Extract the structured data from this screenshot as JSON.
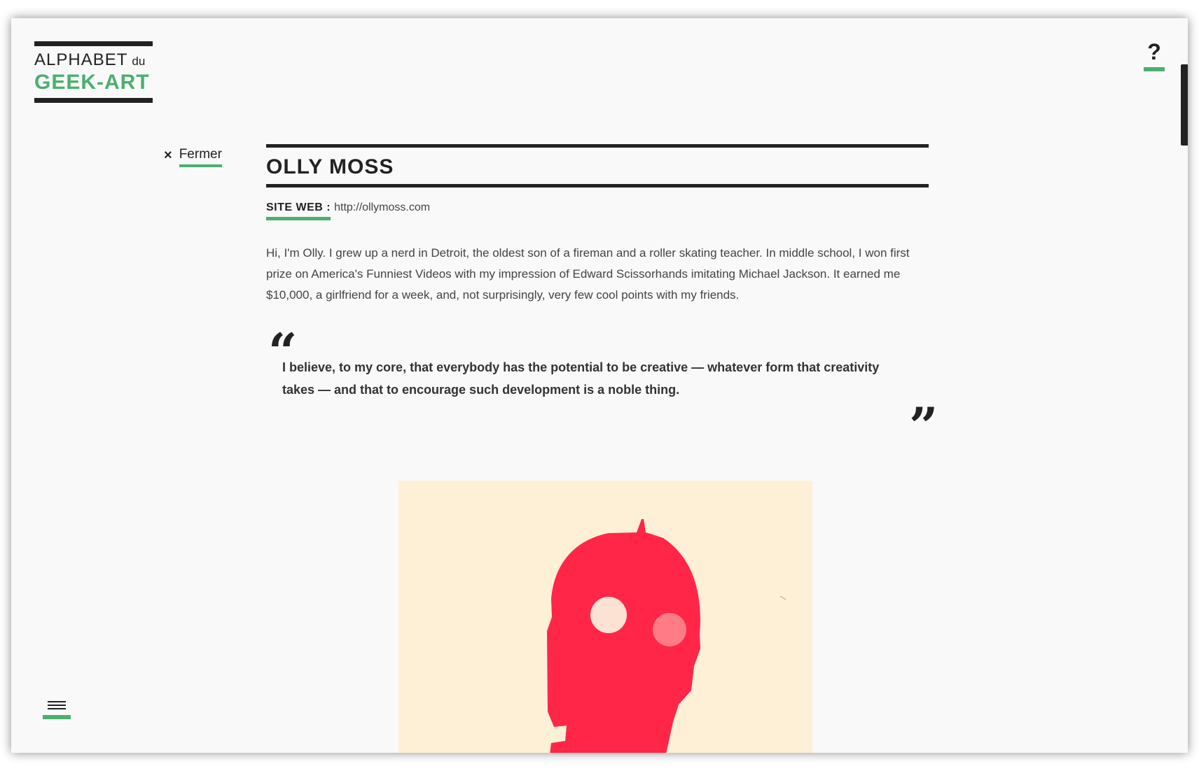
{
  "logo": {
    "line1": "ALPHABET",
    "du": "du",
    "line2": "GEEK-ART"
  },
  "help": {
    "label": "?"
  },
  "close": {
    "icon": "×",
    "label": "Fermer"
  },
  "artist": {
    "name": "OLLY MOSS",
    "site_label": "SITE WEB :",
    "site_url": "http://ollymoss.com",
    "bio": "Hi, I'm Olly. I grew up a nerd in Detroit, the oldest son of a fireman and a roller skating teacher. In middle school, I won first prize on America's Funniest Videos with my impression of Edward Scissorhands imitating Michael Jackson. It earned me $10,000, a girlfriend for a week, and, not surprisingly, very few cool points with my friends.",
    "quote": "I believe, to my core, that everybody has the potential to be creative — whatever form that creativity takes — and that to encourage such development is a noble thing.",
    "quote_open": "“",
    "quote_close": "”"
  },
  "colors": {
    "accent": "#4caf6e",
    "dark": "#222222",
    "artwork_bg": "#fef0d6",
    "artwork_figure": "#ff2648"
  },
  "icons": {
    "menu": "hamburger-icon",
    "close": "close-icon",
    "help": "question-icon"
  }
}
